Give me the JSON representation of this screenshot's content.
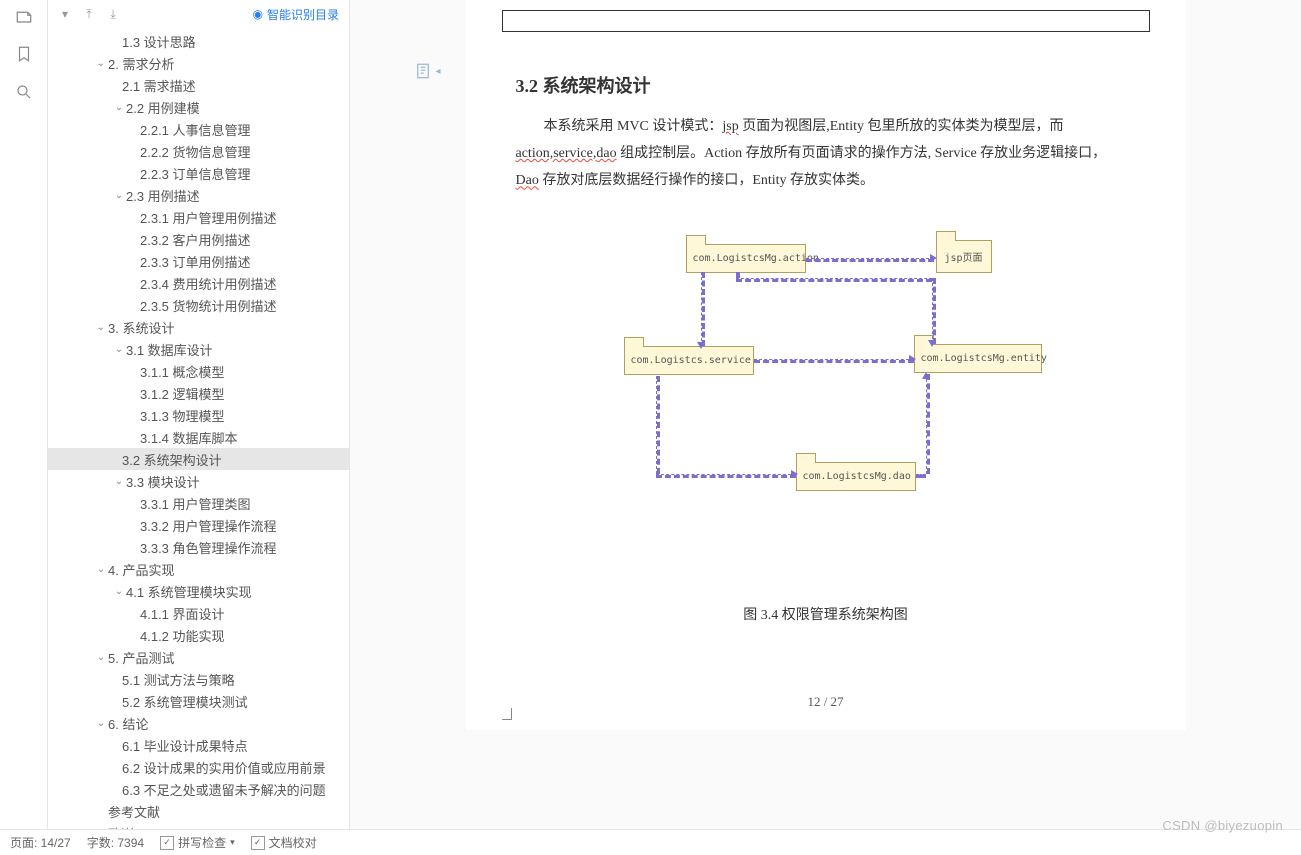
{
  "sidebar_toolbar": {
    "smart_label": "智能识别目录"
  },
  "outline": [
    {
      "label": "1.3 设计思路",
      "depth": "depth-0",
      "chev": ""
    },
    {
      "label": "2. 需求分析",
      "depth": "depth-0c",
      "chev": "⌄"
    },
    {
      "label": "2.1 需求描述",
      "depth": "depth-0",
      "chev": ""
    },
    {
      "label": "2.2 用例建模",
      "depth": "depth-1c",
      "chev": "⌄"
    },
    {
      "label": "2.2.1 人事信息管理",
      "depth": "depth-1",
      "chev": ""
    },
    {
      "label": "2.2.2 货物信息管理",
      "depth": "depth-1",
      "chev": ""
    },
    {
      "label": "2.2.3 订单信息管理",
      "depth": "depth-1",
      "chev": ""
    },
    {
      "label": "2.3 用例描述",
      "depth": "depth-1c",
      "chev": "⌄"
    },
    {
      "label": "2.3.1 用户管理用例描述",
      "depth": "depth-1",
      "chev": ""
    },
    {
      "label": "2.3.2 客户用例描述",
      "depth": "depth-1",
      "chev": ""
    },
    {
      "label": "2.3.3 订单用例描述",
      "depth": "depth-1",
      "chev": ""
    },
    {
      "label": "2.3.4 费用统计用例描述",
      "depth": "depth-1",
      "chev": ""
    },
    {
      "label": "2.3.5 货物统计用例描述",
      "depth": "depth-1",
      "chev": ""
    },
    {
      "label": "3. 系统设计",
      "depth": "depth-0c",
      "chev": "⌄"
    },
    {
      "label": "3.1 数据库设计",
      "depth": "depth-1c",
      "chev": "⌄"
    },
    {
      "label": "3.1.1 概念模型",
      "depth": "depth-1",
      "chev": ""
    },
    {
      "label": "3.1.2 逻辑模型",
      "depth": "depth-1",
      "chev": ""
    },
    {
      "label": "3.1.3 物理模型",
      "depth": "depth-1",
      "chev": ""
    },
    {
      "label": "3.1.4 数据库脚本",
      "depth": "depth-1",
      "chev": ""
    },
    {
      "label": "3.2 系统架构设计",
      "depth": "depth-0",
      "chev": "",
      "active": true
    },
    {
      "label": "3.3 模块设计",
      "depth": "depth-1c",
      "chev": "⌄"
    },
    {
      "label": "3.3.1 用户管理类图",
      "depth": "depth-1",
      "chev": ""
    },
    {
      "label": "3.3.2 用户管理操作流程",
      "depth": "depth-1",
      "chev": ""
    },
    {
      "label": "3.3.3 角色管理操作流程",
      "depth": "depth-1",
      "chev": ""
    },
    {
      "label": "4. 产品实现",
      "depth": "depth-0c",
      "chev": "⌄"
    },
    {
      "label": "4.1 系统管理模块实现",
      "depth": "depth-1c",
      "chev": "⌄"
    },
    {
      "label": "4.1.1 界面设计",
      "depth": "depth-1",
      "chev": ""
    },
    {
      "label": "4.1.2 功能实现",
      "depth": "depth-1",
      "chev": ""
    },
    {
      "label": "5. 产品测试",
      "depth": "depth-0c",
      "chev": "⌄"
    },
    {
      "label": "5.1 测试方法与策略",
      "depth": "depth-0",
      "chev": ""
    },
    {
      "label": "5.2 系统管理模块测试",
      "depth": "depth-0",
      "chev": ""
    },
    {
      "label": "6. 结论",
      "depth": "depth-0c",
      "chev": "⌄"
    },
    {
      "label": "6.1 毕业设计成果特点",
      "depth": "depth-0",
      "chev": ""
    },
    {
      "label": "6.2 设计成果的实用价值或应用前景",
      "depth": "depth-0",
      "chev": ""
    },
    {
      "label": "6.3 不足之处或遗留未予解决的问题",
      "depth": "depth-0",
      "chev": ""
    },
    {
      "label": "参考文献",
      "depth": "depth-0c",
      "chev": ""
    },
    {
      "label": "致谢",
      "depth": "depth-0c",
      "chev": ""
    }
  ],
  "document": {
    "section_title": "3.2  系统架构设计",
    "para1_a": "本系统采用 MVC 设计模式：",
    "para1_jsp": "jsp",
    "para1_b": " 页面为视图层,Entity 包里所放的实体类为模型层，而",
    "para2_a": "action,service,",
    "para2_dao": "dao",
    "para2_b": " 组成控制层。Action 存放所有页面请求的操作方法,  Service 存放业务逻辑接口，",
    "para3_a": "Dao",
    "para3_b": " 存放对底层数据经行操作的接口，Entity  存放实体类。",
    "figure_caption": "图 3.4  权限管理系统架构图",
    "page_number": "12 / 27"
  },
  "diagram": {
    "pkg_action": "com.LogistcsMg.action",
    "pkg_jsp": "jsp页面",
    "pkg_service": "com.Logistcs.service",
    "pkg_entity": "com.LogistcsMg.entity",
    "pkg_dao": "com.LogistcsMg.dao"
  },
  "statusbar": {
    "page_info": "页面: 14/27",
    "word_count": "字数: 7394",
    "spell_check": "拼写检查",
    "doc_proof": "文档校对"
  },
  "watermark": "CSDN @biyezuopin"
}
